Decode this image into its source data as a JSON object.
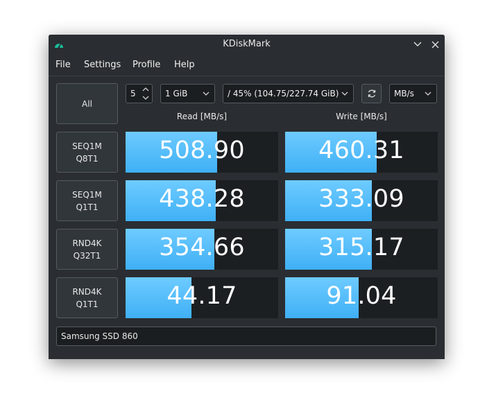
{
  "window": {
    "title": "KDiskMark"
  },
  "menu": [
    "File",
    "Settings",
    "Profile",
    "Help"
  ],
  "controls": {
    "all_label": "All",
    "runs": "5",
    "size": "1 GiB",
    "target": "/ 45% (104.75/227.74 GiB)",
    "units": "MB/s"
  },
  "columns": {
    "read": "Read [MB/s]",
    "write": "Write [MB/s]"
  },
  "tests": [
    {
      "line1": "SEQ1M",
      "line2": "Q8T1",
      "read": "508.90",
      "write": "460.31",
      "read_fill": 0.6,
      "write_fill": 0.6
    },
    {
      "line1": "SEQ1M",
      "line2": "Q1T1",
      "read": "438.28",
      "write": "333.09",
      "read_fill": 0.59,
      "write_fill": 0.57
    },
    {
      "line1": "RND4K",
      "line2": "Q32T1",
      "read": "354.66",
      "write": "315.17",
      "read_fill": 0.58,
      "write_fill": 0.57
    },
    {
      "line1": "RND4K",
      "line2": "Q1T1",
      "read": "44.17",
      "write": "91.04",
      "read_fill": 0.43,
      "write_fill": 0.48
    }
  ],
  "device": "Samsung SSD 860",
  "colors": {
    "bar": "#4ab8f8",
    "background": "#2a2e32",
    "accent_icon": "#1abc9c"
  }
}
